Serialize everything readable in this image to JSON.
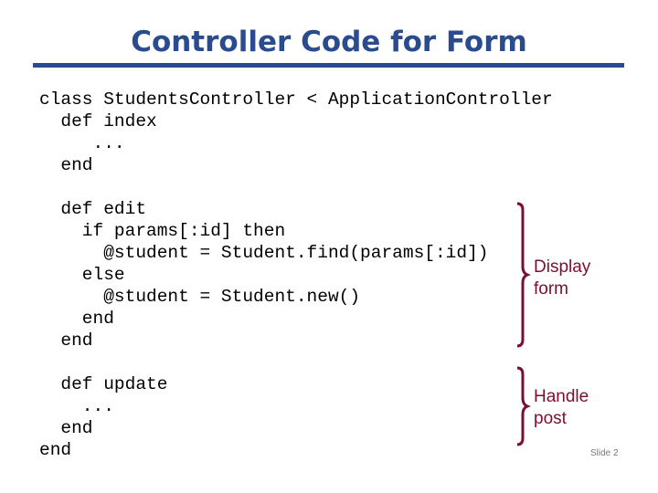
{
  "slide": {
    "title": "Controller Code for Form",
    "code_blocks": {
      "class_header": [
        "class StudentsController < ApplicationController",
        "  def index",
        "     ...",
        "  end"
      ],
      "edit": [
        "  def edit",
        "    if params[:id] then",
        "      @student = Student.find(params[:id])",
        "    else",
        "      @student = Student.new()",
        "    end",
        "  end"
      ],
      "update": [
        "  def update",
        "    ...",
        "  end",
        "end"
      ]
    },
    "annotations": {
      "display": [
        "Display",
        "form"
      ],
      "handle": [
        "Handle",
        "post"
      ]
    },
    "slide_number": "Slide 2",
    "colors": {
      "title": "#2a4b8d",
      "annotation": "#7a1030"
    }
  }
}
